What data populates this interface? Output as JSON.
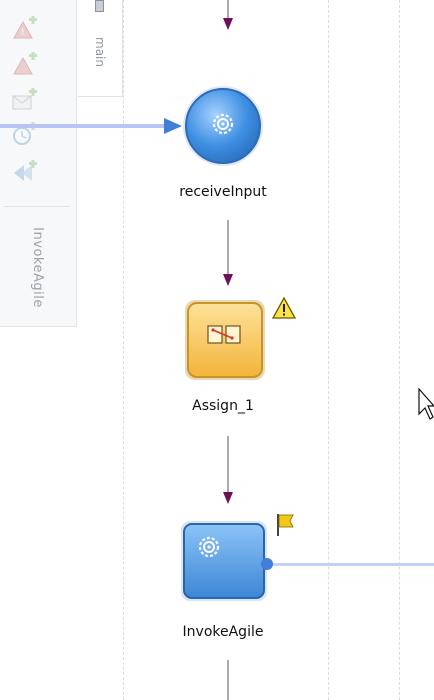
{
  "palette": {
    "label": "InvokeAgile",
    "icons": [
      "throw-add-icon",
      "throw-add-icon",
      "message-add-icon",
      "timer-add-icon",
      "invoke-add-icon"
    ]
  },
  "scope": {
    "label": "main"
  },
  "activities": [
    {
      "name": "receiveInput",
      "kind": "receive"
    },
    {
      "name": "Assign_1",
      "kind": "assign",
      "status": "warning"
    },
    {
      "name": "InvokeAgile",
      "kind": "invoke",
      "status": "flag"
    }
  ],
  "colors": {
    "flow_arrow": "#6e0f57",
    "partner_link": "#b8c4f5",
    "circle_fill": "#3c8be0",
    "assign_fill": "#f7c24f",
    "invoke_fill": "#4a98e6"
  }
}
